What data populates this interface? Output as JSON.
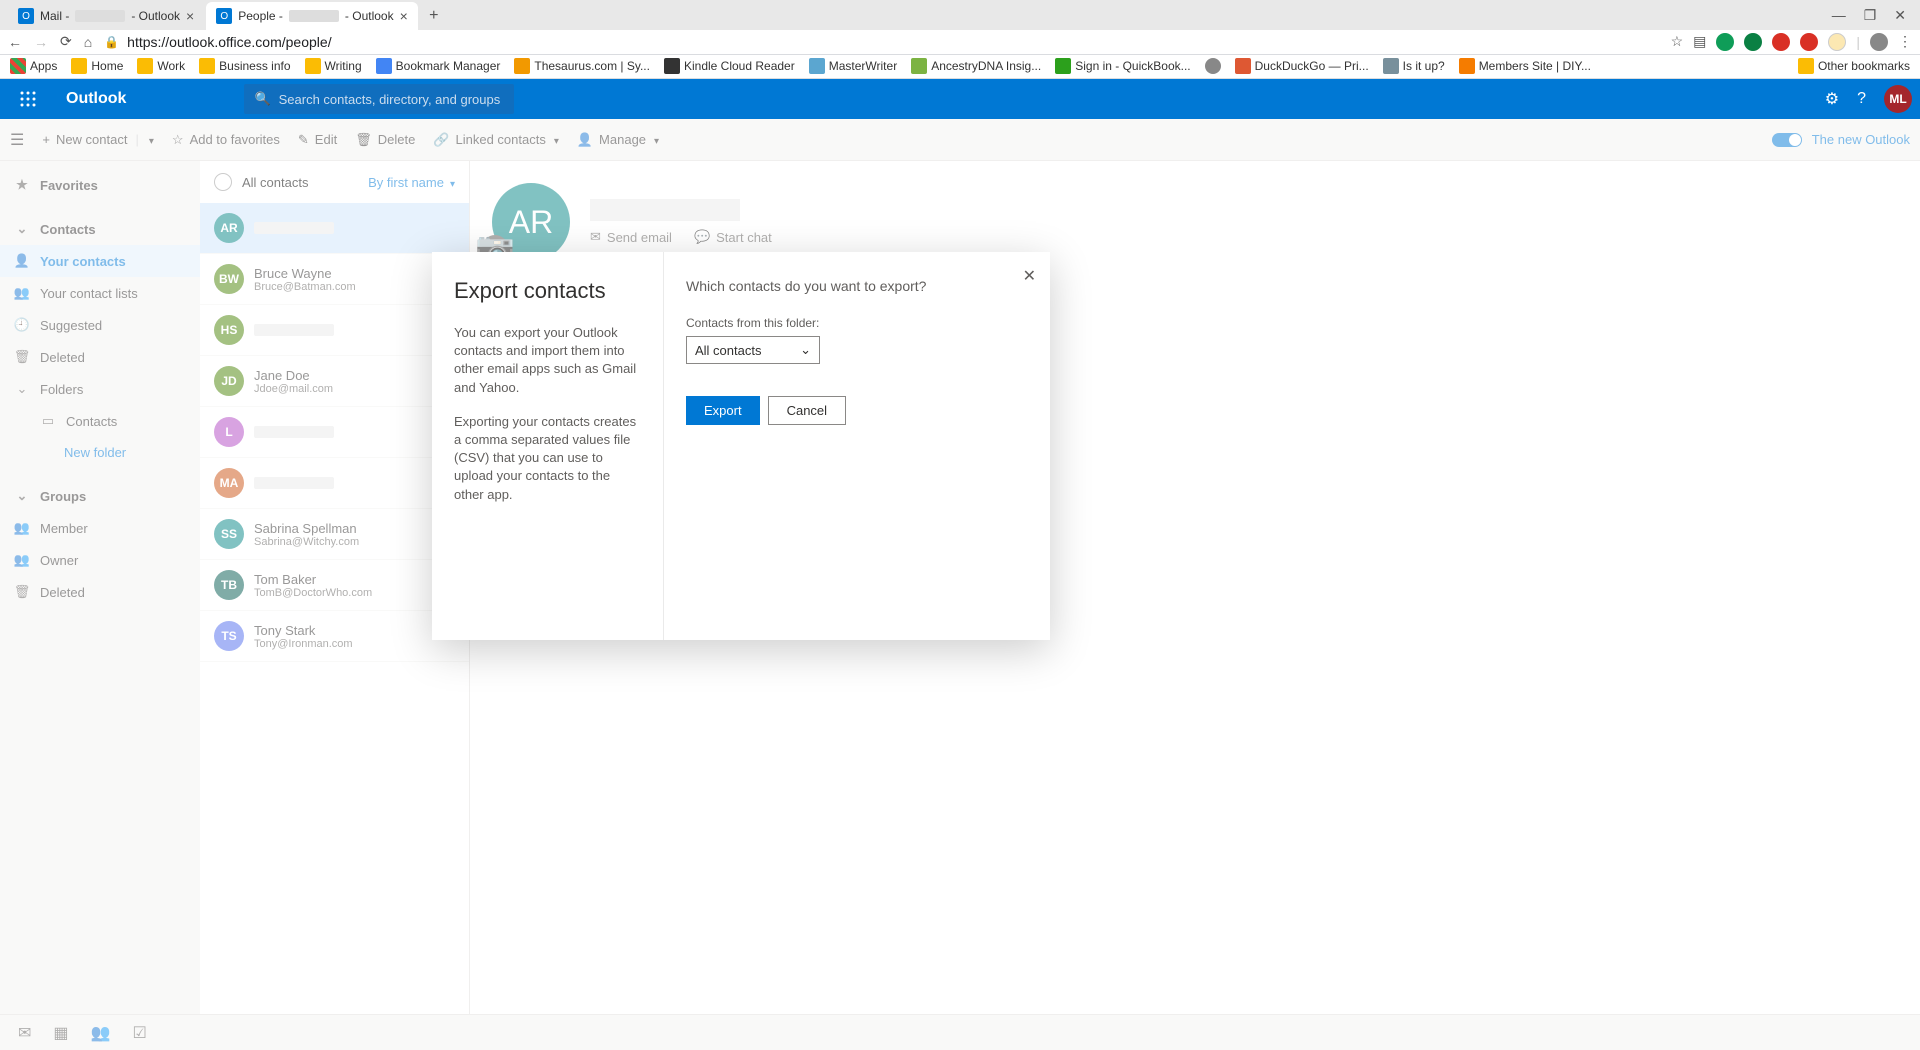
{
  "browser": {
    "tabs": [
      {
        "prefix": "Mail -",
        "suffix": "- Outlook"
      },
      {
        "prefix": "People -",
        "suffix": "- Outlook"
      }
    ],
    "url": "https://outlook.office.com/people/",
    "bookmarks": [
      "Apps",
      "Home",
      "Work",
      "Business info",
      "Writing",
      "Bookmark Manager",
      "Thesaurus.com | Sy...",
      "Kindle Cloud Reader",
      "MasterWriter",
      "AncestryDNA Insig...",
      "Sign in - QuickBook...",
      "DuckDuckGo — Pri...",
      "Is it up?",
      "Members Site | DIY..."
    ],
    "other_bookmarks": "Other bookmarks"
  },
  "suite": {
    "appname": "Outlook",
    "search_placeholder": "Search contacts, directory, and groups",
    "avatar": "ML"
  },
  "cmdbar": {
    "new_contact": "New contact",
    "add_fav": "Add to favorites",
    "edit": "Edit",
    "delete": "Delete",
    "linked": "Linked contacts",
    "manage": "Manage",
    "toggle_label": "The new Outlook"
  },
  "nav": {
    "favorites": "Favorites",
    "contacts": "Contacts",
    "your_contacts": "Your contacts",
    "contact_lists": "Your contact lists",
    "suggested": "Suggested",
    "deleted": "Deleted",
    "folders": "Folders",
    "folder_contacts": "Contacts",
    "new_folder": "New folder",
    "groups": "Groups",
    "member": "Member",
    "owner": "Owner",
    "deleted2": "Deleted"
  },
  "list": {
    "header": "All contacts",
    "sort": "By first name",
    "items": [
      {
        "initials": "AR",
        "name": "",
        "email": "",
        "color": "#028484",
        "redacted": true
      },
      {
        "initials": "BW",
        "name": "Bruce Wayne",
        "email": "Bruce@Batman.com",
        "color": "#498205"
      },
      {
        "initials": "HS",
        "name": "",
        "email": "",
        "color": "#498205",
        "redacted": true
      },
      {
        "initials": "JD",
        "name": "Jane Doe",
        "email": "Jdoe@mail.com",
        "color": "#498205"
      },
      {
        "initials": "L",
        "name": "",
        "email": "",
        "color": "#b146c2",
        "redacted": true
      },
      {
        "initials": "MA",
        "name": "",
        "email": "",
        "color": "#ca5010",
        "redacted": true
      },
      {
        "initials": "SS",
        "name": "Sabrina Spellman",
        "email": "Sabrina@Witchy.com",
        "color": "#028484"
      },
      {
        "initials": "TB",
        "name": "Tom Baker",
        "email": "TomB@DoctorWho.com",
        "color": "#00594f"
      },
      {
        "initials": "TS",
        "name": "Tony Stark",
        "email": "Tony@Ironman.com",
        "color": "#4f6bed"
      }
    ]
  },
  "detail": {
    "initials": "AR",
    "send_email": "Send email",
    "start_chat": "Start chat"
  },
  "modal": {
    "title": "Export contacts",
    "para1": "You can export your Outlook contacts and import them into other email apps such as Gmail and Yahoo.",
    "para2": "Exporting your contacts creates a comma separated values file (CSV) that you can use to upload your contacts to the other app.",
    "question": "Which contacts do you want to export?",
    "field_label": "Contacts from this folder:",
    "select_value": "All contacts",
    "export": "Export",
    "cancel": "Cancel"
  }
}
